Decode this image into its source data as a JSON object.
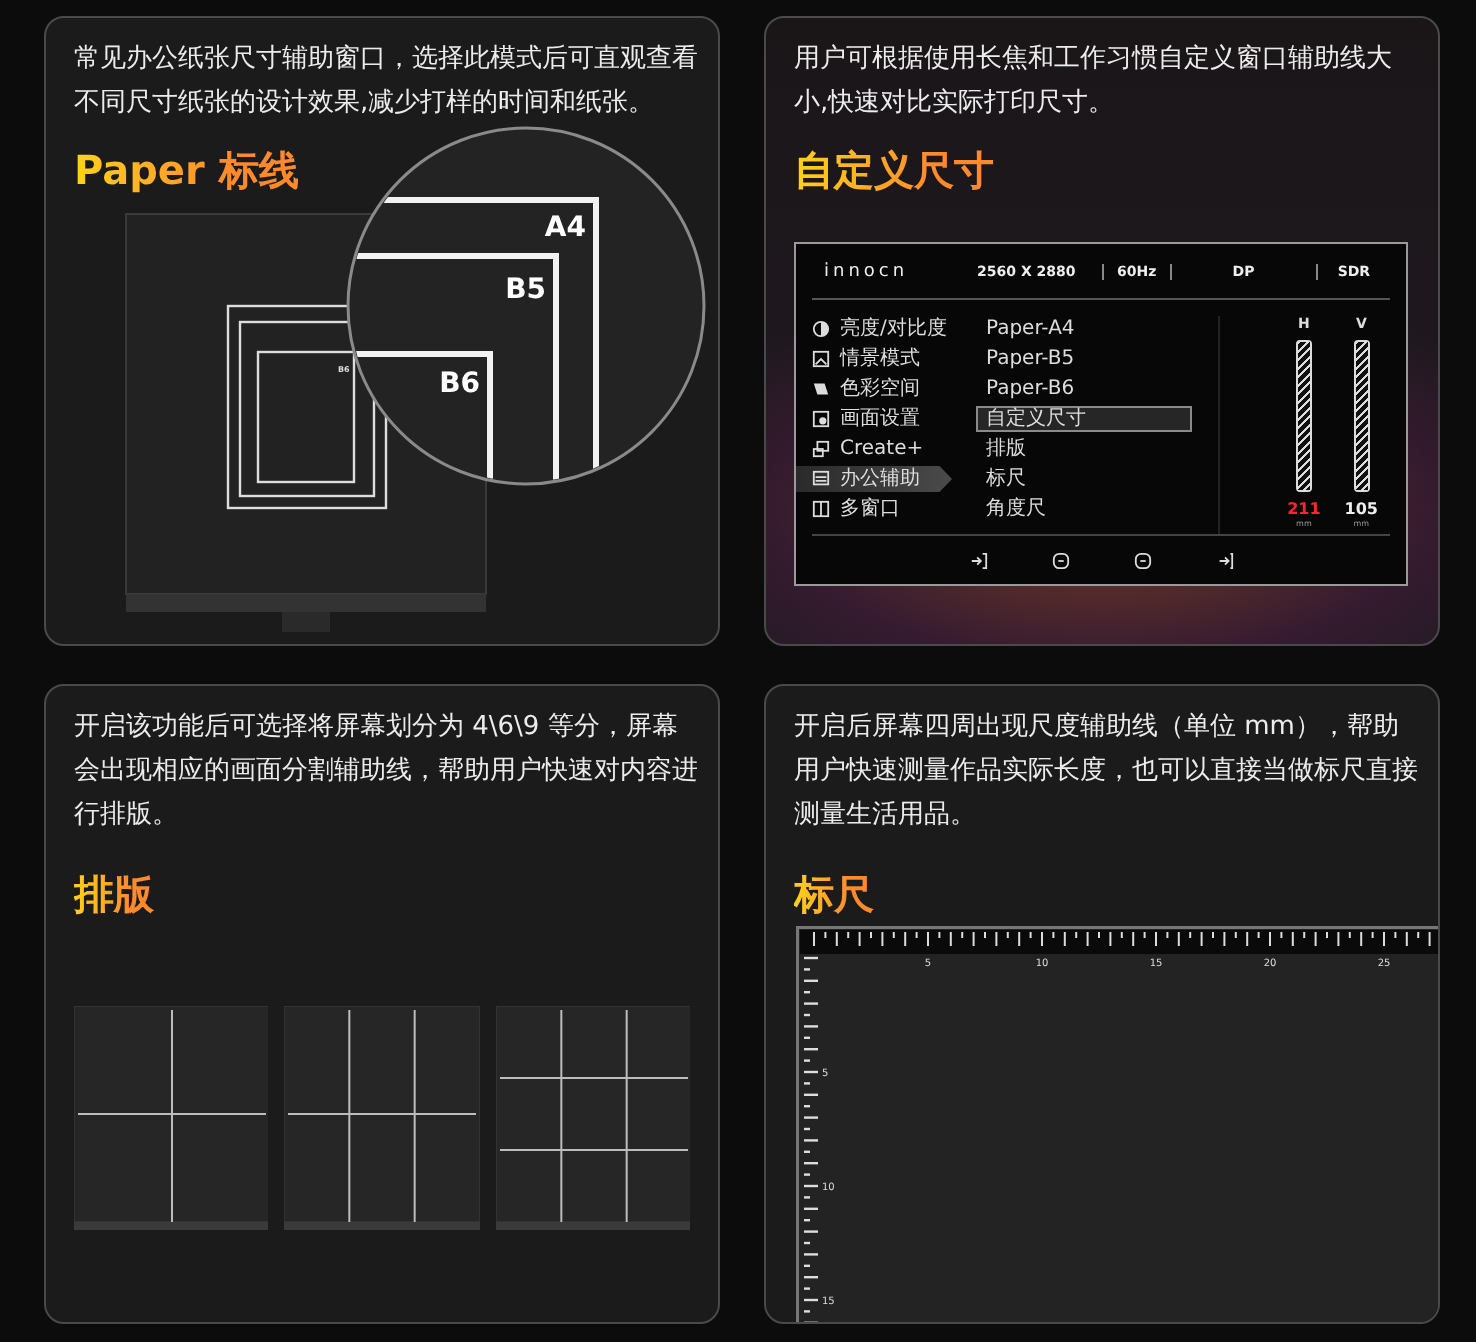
{
  "cards": [
    {
      "kind": "paper",
      "description": "常见办公纸张尺寸辅助窗口，选择此模式后可直观查看不同尺寸纸张的设计效果,减少打样的时间和纸张。",
      "title": "Paper 标线",
      "zoom_labels": [
        "A4",
        "B5",
        "B6"
      ],
      "screen_label": "B6"
    },
    {
      "kind": "osd",
      "description": "用户可根据使用长焦和工作习惯自定义窗口辅助线大小,快速对比实际打印尺寸。",
      "title": "自定义尺寸",
      "osd": {
        "logo": "innocn",
        "header": [
          "2560 X 2880",
          "60Hz",
          "DP",
          "SDR"
        ],
        "menu": [
          {
            "label": "亮度/对比度",
            "selected": false
          },
          {
            "label": "情景模式",
            "selected": false
          },
          {
            "label": "色彩空间",
            "selected": false
          },
          {
            "label": "画面设置",
            "selected": false
          },
          {
            "label": "Create+",
            "selected": false
          },
          {
            "label": "办公辅助",
            "selected": true
          },
          {
            "label": "多窗口",
            "selected": false
          }
        ],
        "submenu": [
          {
            "label": "Paper-A4",
            "selected": false
          },
          {
            "label": "Paper-B5",
            "selected": false
          },
          {
            "label": "Paper-B6",
            "selected": false
          },
          {
            "label": "自定义尺寸",
            "selected": true
          },
          {
            "label": "排版",
            "selected": false
          },
          {
            "label": "标尺",
            "selected": false
          },
          {
            "label": "角度尺",
            "selected": false
          }
        ],
        "sliders": [
          {
            "label": "H",
            "value": "211",
            "unit": "mm",
            "highlighted": true,
            "level": 1
          },
          {
            "label": "V",
            "value": "105",
            "unit": "mm",
            "highlighted": false,
            "level": 1
          }
        ]
      }
    },
    {
      "kind": "layout",
      "description": "开启该功能后可选择将屏幕划分为 4\\6\\9 等分，屏幕会出现相应的画面分割辅助线，帮助用户快速对内容进行排版。",
      "title": "排版",
      "layouts": [
        {
          "kind": "quarters"
        },
        {
          "kind": "sixths"
        },
        {
          "kind": "ninths"
        }
      ]
    },
    {
      "kind": "ruler",
      "description": "开启后屏幕四周出现尺度辅助线（单位 mm），帮助用户快速测量作品实际长度，也可以直接当做标尺直接测量生活用品。",
      "title": "标尺",
      "top_labels": [
        "5",
        "10",
        "15",
        "20",
        "25"
      ],
      "left_labels": [
        "5",
        "10",
        "15"
      ]
    }
  ]
}
